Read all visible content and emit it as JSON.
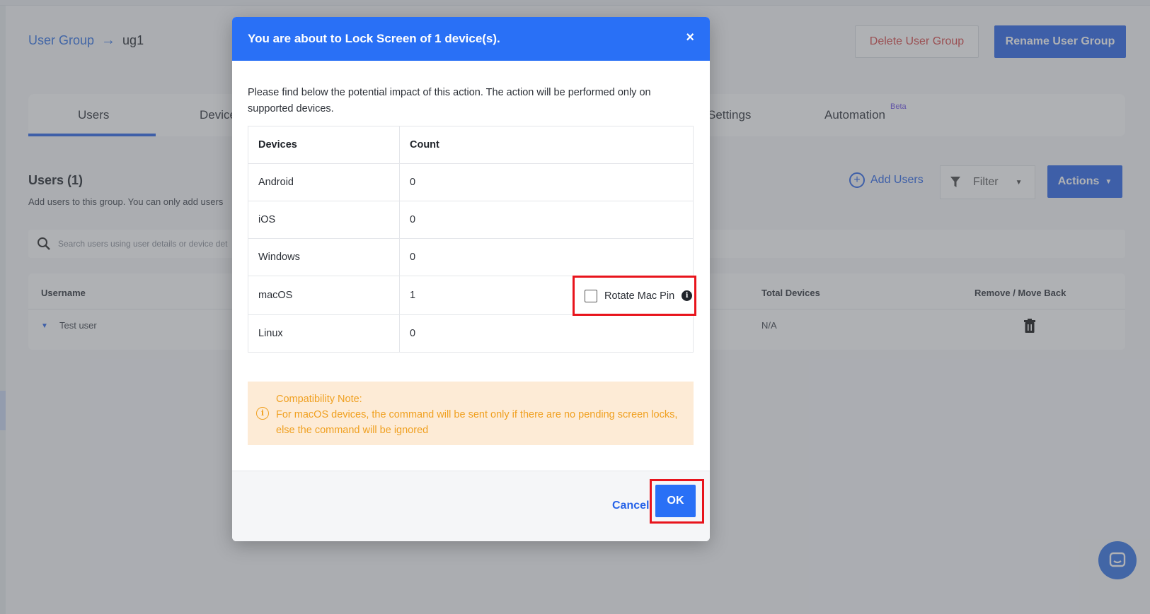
{
  "breadcrumb": {
    "root": "User Group",
    "arrow": "→",
    "current": "ug1"
  },
  "header_buttons": {
    "delete": "Delete User Group",
    "rename": "Rename User Group"
  },
  "tabs": {
    "users": "Users",
    "devices": "Device",
    "settings": "Settings",
    "automation": "Automation",
    "automation_badge": "Beta"
  },
  "users_section": {
    "title": "Users (1)",
    "subtitle": "Add users to this group. You can only add users",
    "add_users": "Add Users",
    "filter": "Filter",
    "actions": "Actions",
    "search_placeholder": "Search users using user details or device det"
  },
  "users_table": {
    "headers": {
      "username": "Username",
      "total_devices": "Total Devices",
      "remove": "Remove / Move Back"
    },
    "rows": [
      {
        "username": "Test user",
        "total_devices": "N/A"
      }
    ]
  },
  "modal": {
    "title": "You are about to Lock Screen of 1 device(s).",
    "close": "×",
    "description": "Please find below the potential impact of this action. The action will be performed only on supported devices.",
    "table": {
      "headers": {
        "devices": "Devices",
        "count": "Count"
      },
      "rows": [
        {
          "device": "Android",
          "count": "0"
        },
        {
          "device": "iOS",
          "count": "0"
        },
        {
          "device": "Windows",
          "count": "0"
        },
        {
          "device": "macOS",
          "count": "1"
        },
        {
          "device": "Linux",
          "count": "0"
        }
      ]
    },
    "rotate_mac_pin": {
      "label": "Rotate Mac Pin",
      "checked": false
    },
    "compat_note": {
      "title": "Compatibility Note:",
      "text": "For macOS devices, the command will be sent only if there are no pending screen locks, else the command will be ignored"
    },
    "buttons": {
      "cancel": "Cancel",
      "ok": "OK"
    }
  },
  "colors": {
    "primary": "#2970f6",
    "highlight": "#e8141c",
    "warning_text": "#f0a020",
    "warning_bg": "#fdebd6",
    "danger": "#d64545"
  }
}
